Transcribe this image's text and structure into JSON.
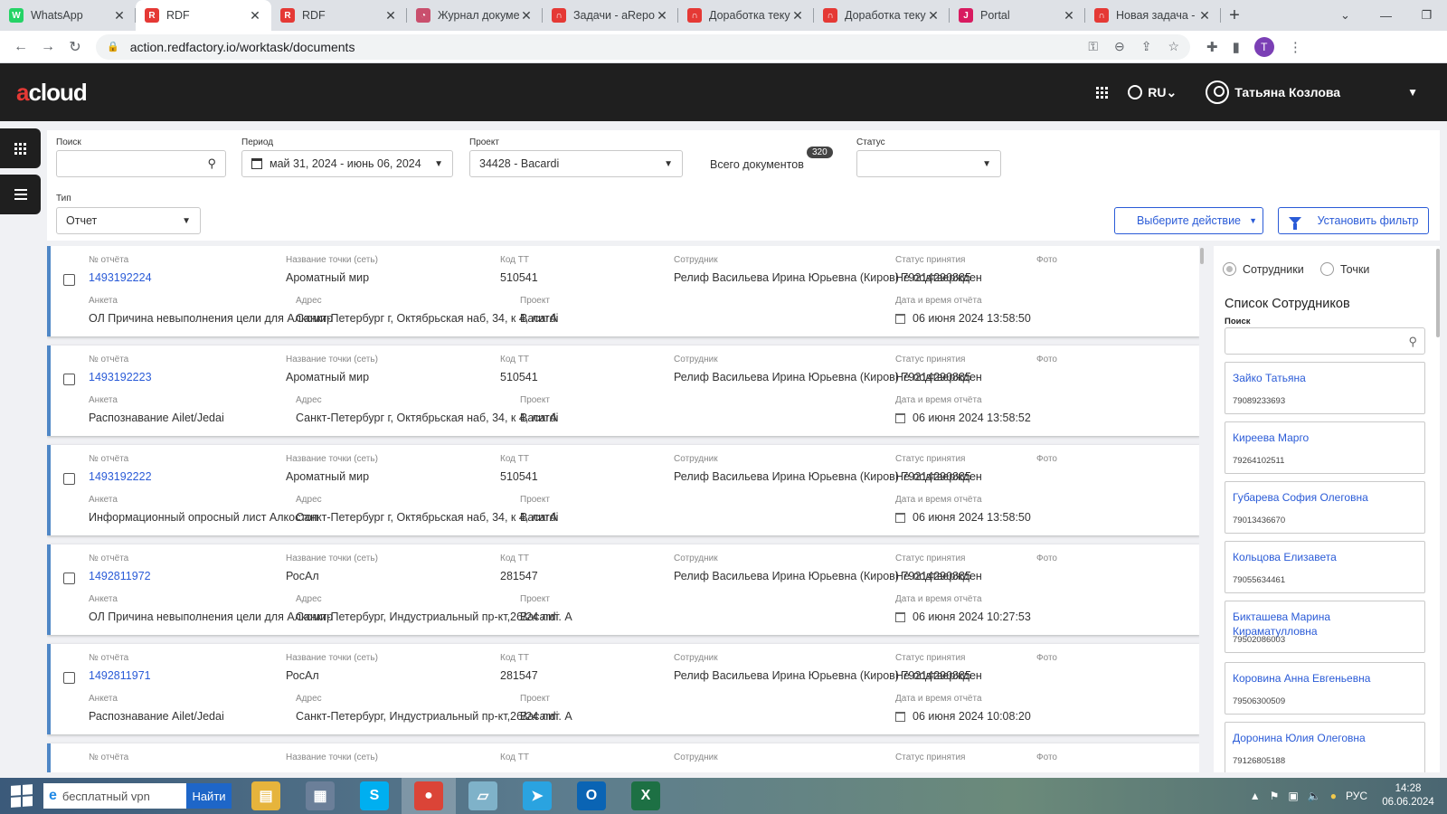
{
  "browser": {
    "tabs": [
      {
        "title": "WhatsApp",
        "fav_color": "#25d366",
        "fav_glyph": "W"
      },
      {
        "title": "RDF",
        "fav_color": "#e53935",
        "fav_glyph": "R",
        "active": true
      },
      {
        "title": "RDF",
        "fav_color": "#e53935",
        "fav_glyph": "R"
      },
      {
        "title": "Журнал докуме",
        "fav_color": "#c94f6d",
        "fav_glyph": "◔"
      },
      {
        "title": "Задачи - aRepo",
        "fav_color": "#e53935",
        "fav_glyph": "∩"
      },
      {
        "title": "Доработка теку",
        "fav_color": "#e53935",
        "fav_glyph": "∩"
      },
      {
        "title": "Доработка теку",
        "fav_color": "#e53935",
        "fav_glyph": "∩"
      },
      {
        "title": "Portal",
        "fav_color": "#d81b60",
        "fav_glyph": "J"
      },
      {
        "title": "Новая задача -",
        "fav_color": "#e53935",
        "fav_glyph": "∩"
      }
    ],
    "url": "action.redfactory.io/worktask/documents",
    "profile_initial": "T"
  },
  "app": {
    "logo_a": "a",
    "logo_rest": "cloud",
    "lang": "RU",
    "user": "Татьяна Козлова"
  },
  "filters": {
    "search_label": "Поиск",
    "search_value": "",
    "period_label": "Период",
    "period_value": "май 31, 2024 - июнь 06, 2024",
    "project_label": "Проект",
    "project_value": "34428 - Bacardi",
    "total_label": "Всего документов",
    "total_count": "320",
    "status_label": "Статус",
    "status_value": "",
    "type_label": "Тип",
    "type_value": "Отчет",
    "action_button": "Выберите действие",
    "filter_button": "Установить фильтр"
  },
  "labels": {
    "report_no": "№ отчёта",
    "point_name": "Название точки (сеть)",
    "tt_code": "Код ТТ",
    "employee": "Сотрудник",
    "accept_status": "Статус принятия",
    "photo": "Фото",
    "survey": "Анкета",
    "address": "Адрес",
    "project": "Проект",
    "datetime": "Дата и время отчёта"
  },
  "reports": [
    {
      "no": "1493192224",
      "point": "Ароматный мир",
      "code": "510541",
      "employee": "Релиф Васильева Ирина Юрьевна (Киров) 79214290885",
      "status": "Не подтвержден",
      "survey": "ОЛ Причина невыполнения цели для Алкомир",
      "address": "Санкт-Петербург г, Октябрьская наб, 34, к 4, литА",
      "project": "Bacardi",
      "datetime": "06 июня 2024 13:58:50"
    },
    {
      "no": "1493192223",
      "point": "Ароматный мир",
      "code": "510541",
      "employee": "Релиф Васильева Ирина Юрьевна (Киров) 79214290885",
      "status": "Не подтвержден",
      "survey": "Распознавание Ailet/Jedai",
      "address": "Санкт-Петербург г, Октябрьская наб, 34, к 4, литА",
      "project": "Bacardi",
      "datetime": "06 июня 2024 13:58:52"
    },
    {
      "no": "1493192222",
      "point": "Ароматный мир",
      "code": "510541",
      "employee": "Релиф Васильева Ирина Юрьевна (Киров) 79214290885",
      "status": "Не подтвержден",
      "survey": "Информационный опросный лист Алкостоп",
      "address": "Санкт-Петербург г, Октябрьская наб, 34, к 4, литА",
      "project": "Bacardi",
      "datetime": "06 июня 2024 13:58:50"
    },
    {
      "no": "1492811972",
      "point": "РосАл",
      "code": "281547",
      "employee": "Релиф Васильева Ирина Юрьевна (Киров) 79214290885",
      "status": "Не подтвержден",
      "survey": "ОЛ Причина невыполнения цели для Алкомир",
      "address": "Санкт-Петербург, Индустриальный пр-кт,26/24 лит. А",
      "project": "Bacardi",
      "datetime": "06 июня 2024 10:27:53"
    },
    {
      "no": "1492811971",
      "point": "РосАл",
      "code": "281547",
      "employee": "Релиф Васильева Ирина Юрьевна (Киров) 79214290885",
      "status": "Не подтвержден",
      "survey": "Распознавание Ailet/Jedai",
      "address": "Санкт-Петербург, Индустриальный пр-кт,26/24 лит. А",
      "project": "Bacardi",
      "datetime": "06 июня 2024 10:08:20"
    }
  ],
  "panel": {
    "radio_employees": "Сотрудники",
    "radio_points": "Точки",
    "title": "Список Сотрудников",
    "search_label": "Поиск",
    "employees": [
      {
        "name": "Зайко Татьяна",
        "phone": "79089233693"
      },
      {
        "name": "Киреева Марго",
        "phone": "79264102511"
      },
      {
        "name": "Губарева София Олеговна",
        "phone": "79013436670"
      },
      {
        "name": "Кольцова Елизавета",
        "phone": "79055634461"
      },
      {
        "name": "Бикташева Марина Кираматулловна",
        "phone": "79502086003"
      },
      {
        "name": "Коровина Анна Евгеньевна",
        "phone": "79506300509"
      },
      {
        "name": "Доронина Юлия Олеговна",
        "phone": "79126805188"
      }
    ]
  },
  "taskbar": {
    "search_text": "бесплатный vpn",
    "search_button": "Найти",
    "lang": "РУС",
    "time": "14:28",
    "date": "06.06.2024",
    "apps": [
      {
        "name": "explorer",
        "color": "#e6b43c",
        "glyph": "▤"
      },
      {
        "name": "calculator",
        "color": "#6b7f99",
        "glyph": "▦"
      },
      {
        "name": "skype",
        "color": "#00aff0",
        "glyph": "S"
      },
      {
        "name": "chrome",
        "color": "#db4437",
        "glyph": "●",
        "active": true
      },
      {
        "name": "notes",
        "color": "#7fb2c9",
        "glyph": "▱"
      },
      {
        "name": "telegram",
        "color": "#2aa3e0",
        "glyph": "➤"
      },
      {
        "name": "outlook",
        "color": "#0a64b4",
        "glyph": "O"
      },
      {
        "name": "excel",
        "color": "#1d7044",
        "glyph": "X"
      }
    ]
  }
}
